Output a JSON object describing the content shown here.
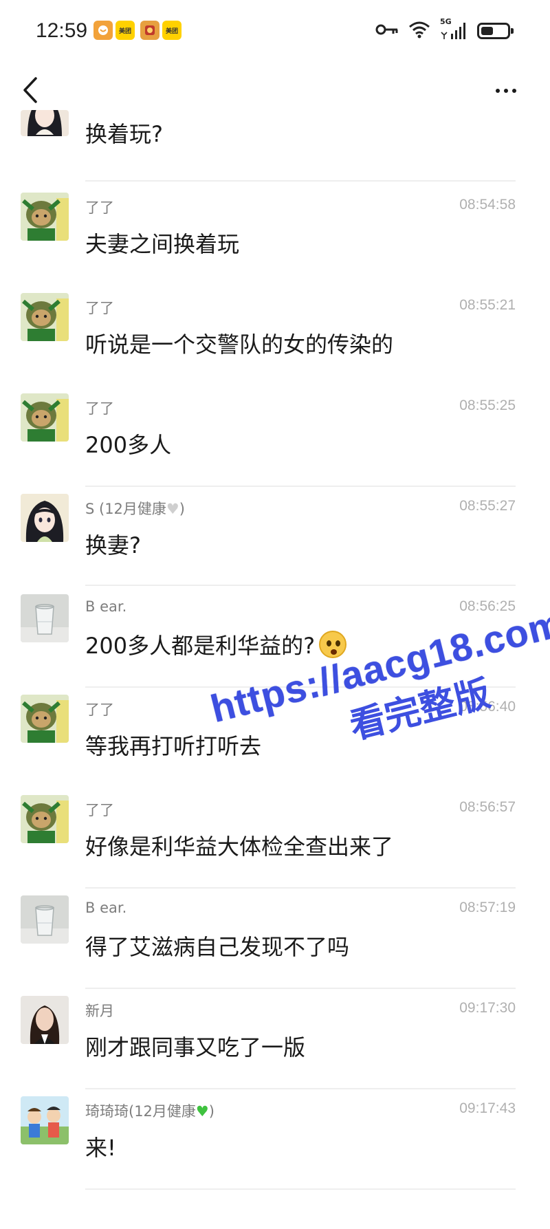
{
  "status_bar": {
    "time": "12:59",
    "badges": [
      {
        "icon": "app-badge-icon",
        "color": "#f2a23a"
      },
      {
        "icon": "meituan-icon",
        "label": "美团",
        "color": "#ffd100"
      },
      {
        "icon": "app-badge-icon",
        "color": "#e7a040"
      },
      {
        "icon": "meituan-icon",
        "label": "美团",
        "color": "#ffd100"
      }
    ],
    "network": "5G",
    "battery_level": 0.4
  },
  "nav": {
    "back_icon": "chevron-left-icon",
    "more_icon": "more-horizontal-icon"
  },
  "messages": [
    {
      "sender": "",
      "time": "",
      "text": "换着玩?",
      "avatar": "anime-girl"
    },
    {
      "sender": "了了",
      "time": "08:54:58",
      "text": "夫妻之间换着玩",
      "avatar": "green-character"
    },
    {
      "sender": "了了",
      "time": "08:55:21",
      "text": "听说是一个交警队的女的传染的",
      "avatar": "green-character"
    },
    {
      "sender": "了了",
      "time": "08:55:25",
      "text": "200多人",
      "avatar": "green-character"
    },
    {
      "sender": "S (12月健康",
      "sender_suffix": ")",
      "heart": "white",
      "time": "08:55:27",
      "text": "换妻?",
      "avatar": "anime-girl"
    },
    {
      "sender": "B ear.",
      "time": "08:56:25",
      "text": "200多人都是利华益的?",
      "emoji": "shocked-face",
      "avatar": "glass"
    },
    {
      "sender": "了了",
      "time": "08:56:40",
      "text": "等我再打听打听去",
      "avatar": "green-character"
    },
    {
      "sender": "了了",
      "time": "08:56:57",
      "text": "好像是利华益大体检全查出来了",
      "avatar": "green-character"
    },
    {
      "sender": "B ear.",
      "time": "08:57:19",
      "text": "得了艾滋病自己发现不了吗",
      "avatar": "glass"
    },
    {
      "sender": "新月",
      "time": "09:17:30",
      "text": "刚才跟同事又吃了一版",
      "avatar": "woman-photo"
    },
    {
      "sender": "琦琦琦(12月健康",
      "sender_suffix": ")",
      "heart": "green",
      "time": "09:17:43",
      "text": "来!",
      "avatar": "cartoon-group"
    }
  ],
  "watermark": {
    "url": "https://aacg18.com",
    "subtitle": "看完整版",
    "color": "#3d4fe0"
  }
}
